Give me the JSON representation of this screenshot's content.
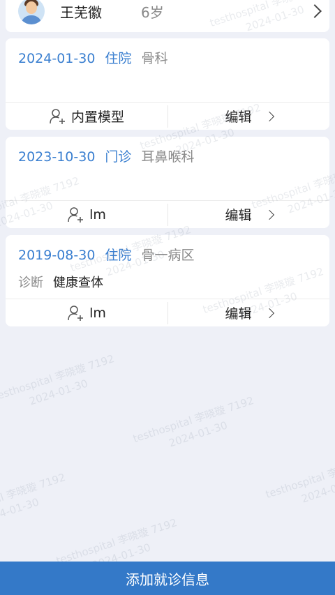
{
  "patient": {
    "name": "王芜徽",
    "age": "6岁"
  },
  "visits": [
    {
      "date": "2024-01-30",
      "type": "住院",
      "dept": "骨科",
      "diag_label": "",
      "diag_value": "",
      "doctor": "内置模型",
      "edit_label": "编辑"
    },
    {
      "date": "2023-10-30",
      "type": "门诊",
      "dept": "耳鼻喉科",
      "diag_label": "",
      "diag_value": "",
      "doctor": "lm",
      "edit_label": "编辑"
    },
    {
      "date": "2019-08-30",
      "type": "住院",
      "dept": "骨一病区",
      "diag_label": "诊断",
      "diag_value": "健康查体",
      "doctor": "lm",
      "edit_label": "编辑"
    }
  ],
  "add_button_label": "添加就诊信息",
  "watermark": {
    "line1": "testhospital 李晓璇 7192",
    "line2": "2024-01-30"
  },
  "colors": {
    "accent": "#3a7fd0",
    "button": "#3479c8",
    "background": "#eef0f7"
  }
}
